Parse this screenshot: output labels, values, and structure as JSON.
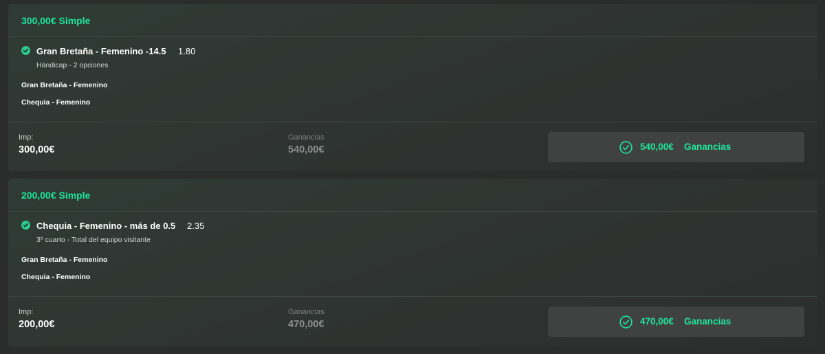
{
  "bets": [
    {
      "title": "300,00€ Simple",
      "selection": {
        "name": "Gran Bretaña - Femenino -14.5",
        "odds": "1.80",
        "market": "Hándicap - 2 opciones"
      },
      "teams": [
        "Gran Bretaña - Femenino",
        "Chequia - Femenino"
      ],
      "stake_label": "Imp:",
      "stake_value": "300,00€",
      "potential_label": "Ganancias",
      "potential_value": "540,00€",
      "result_amount": "540,00€",
      "result_label": "Ganancias",
      "icon": "check-circle-icon"
    },
    {
      "title": "200,00€ Simple",
      "selection": {
        "name": "Chequia - Femenino - más de 0.5",
        "odds": "2.35",
        "market": "3º cuarto - Total del equipo visitante"
      },
      "teams": [
        "Gran Bretaña - Femenino",
        "Chequia - Femenino"
      ],
      "stake_label": "Imp:",
      "stake_value": "200,00€",
      "potential_label": "Ganancias",
      "potential_value": "470,00€",
      "result_amount": "470,00€",
      "result_label": "Ganancias",
      "icon": "check-circle-icon"
    }
  ],
  "colors": {
    "accent": "#1ee6a0",
    "check_badge": "#2cc98e",
    "background": "#2b2d2c",
    "result_box": "#404241"
  }
}
